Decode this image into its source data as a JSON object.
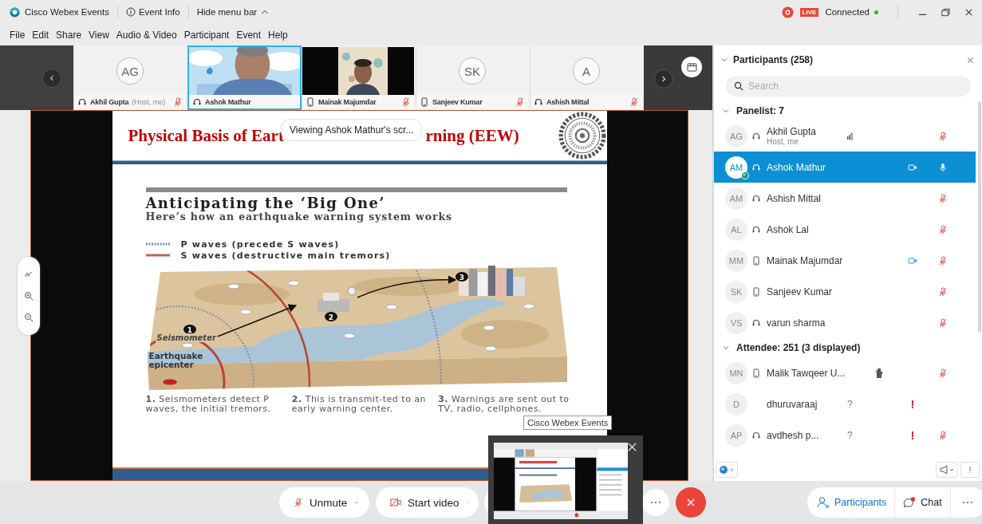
{
  "title_bar": {
    "app_name": "Cisco Webex Events",
    "event_info": "Event Info",
    "hide_menu": "Hide menu bar",
    "live_badge": "LIVE",
    "status": "Connected"
  },
  "menu": [
    "File",
    "Edit",
    "Share",
    "View",
    "Audio & Video",
    "Participant",
    "Event",
    "Help"
  ],
  "video_strip": {
    "tiles": [
      {
        "kind": "avatar",
        "initials": "AG",
        "name": "Akhil Gupta",
        "note": "(Host, me)",
        "headset": true,
        "phone": false,
        "muted": true,
        "selected": false
      },
      {
        "kind": "video",
        "name": "Ashok Mathur",
        "headset": true,
        "phone": false,
        "muted": false,
        "selected": true
      },
      {
        "kind": "video",
        "name": "Mainak Majumdar",
        "headset": false,
        "phone": true,
        "muted": true,
        "selected": false
      },
      {
        "kind": "avatar",
        "initials": "SK",
        "name": "Sanjeev Kumar",
        "headset": false,
        "phone": true,
        "muted": true,
        "selected": false
      },
      {
        "kind": "avatar",
        "initials": "A",
        "name": "Ashish Mittal",
        "headset": true,
        "phone": false,
        "muted": true,
        "selected": false
      }
    ]
  },
  "shared_screen": {
    "viewing": "Viewing Ashok Mathur's scr...",
    "tooltip": "Cisco Webex Events",
    "slide": {
      "title_left": "Physical Basis of Eart",
      "title_right": "rning (EEW)",
      "heading": "Anticipating the ‘Big One’",
      "subheading": "Here’s how an earthquake warning system works",
      "legend": [
        {
          "kind": "p",
          "label": "P waves (precede S waves)"
        },
        {
          "kind": "s",
          "label": "S waves (destructive main tremors)"
        }
      ],
      "map_labels": {
        "seismometer": "Seismometer",
        "epicenter": "Earthquake epicenter"
      },
      "markers": [
        "1",
        "2",
        "3"
      ],
      "steps": [
        "**1.** Seismometers detect P waves, the initial tremors.",
        "**2.** This is transmit-ted to an early warning center.",
        "**3.** Warnings are sent out to TV, radio, cellphones."
      ]
    }
  },
  "controls": {
    "unmute": "Unmute",
    "start_video": "Start video",
    "participants": "Participants",
    "chat": "Chat",
    "chat_unread": true
  },
  "participants_panel": {
    "title": "Participants (258)",
    "search_placeholder": "Search",
    "sections": [
      {
        "label": "Panelist: 7",
        "expanded": true,
        "rows": [
          {
            "initials": "AG",
            "name": "Akhil Gupta",
            "sub": "Host, me",
            "headset": true,
            "phone": false,
            "selected": false,
            "sharing": false,
            "speaking": true,
            "hand": false,
            "video": false,
            "muted": true,
            "mic_on": false
          },
          {
            "initials": "AM",
            "name": "Ashok Mathur",
            "headset": true,
            "phone": false,
            "selected": true,
            "sharing": true,
            "speaking": false,
            "hand": false,
            "video": true,
            "muted": false,
            "mic_on": true
          },
          {
            "initials": "AM",
            "name": "Ashish Mittal",
            "headset": true,
            "phone": false,
            "selected": false,
            "sharing": false,
            "speaking": false,
            "hand": false,
            "video": false,
            "muted": true,
            "mic_on": false
          },
          {
            "initials": "AL",
            "name": "Ashok Lal",
            "headset": true,
            "phone": false,
            "selected": false,
            "sharing": false,
            "speaking": false,
            "hand": false,
            "video": false,
            "muted": true,
            "mic_on": false
          },
          {
            "initials": "MM",
            "name": "Mainak Majumdar",
            "headset": false,
            "phone": true,
            "selected": false,
            "sharing": false,
            "speaking": false,
            "hand": false,
            "video": true,
            "muted": true,
            "mic_on": false
          },
          {
            "initials": "SK",
            "name": "Sanjeev Kumar",
            "headset": false,
            "phone": true,
            "selected": false,
            "sharing": false,
            "speaking": false,
            "hand": false,
            "video": false,
            "muted": true,
            "mic_on": false
          },
          {
            "initials": "VS",
            "name": "varun sharma",
            "headset": true,
            "phone": false,
            "selected": false,
            "sharing": false,
            "speaking": false,
            "hand": false,
            "video": false,
            "muted": true,
            "mic_on": false
          }
        ]
      },
      {
        "label": "Attendee: 251 (3 displayed)",
        "expanded": true,
        "rows": [
          {
            "initials": "MN",
            "name": "Malik Tawqeer U...",
            "headset": false,
            "phone": true,
            "selected": false,
            "sharing": false,
            "speaking": false,
            "hand": true,
            "video": false,
            "muted": true,
            "mic_on": false
          },
          {
            "initials": "D",
            "name": "dhuruvaraaj",
            "question": "?",
            "alert": "!",
            "headset": false,
            "phone": false,
            "selected": false,
            "sharing": false,
            "speaking": false,
            "hand": false,
            "video": false,
            "muted": false,
            "mic_on": false
          },
          {
            "initials": "AP",
            "name": "avdhesh p...",
            "question": "?",
            "alert": "!",
            "headset": true,
            "phone": false,
            "selected": false,
            "sharing": false,
            "speaking": false,
            "hand": false,
            "video": false,
            "muted": true,
            "mic_on": false
          }
        ]
      }
    ]
  }
}
